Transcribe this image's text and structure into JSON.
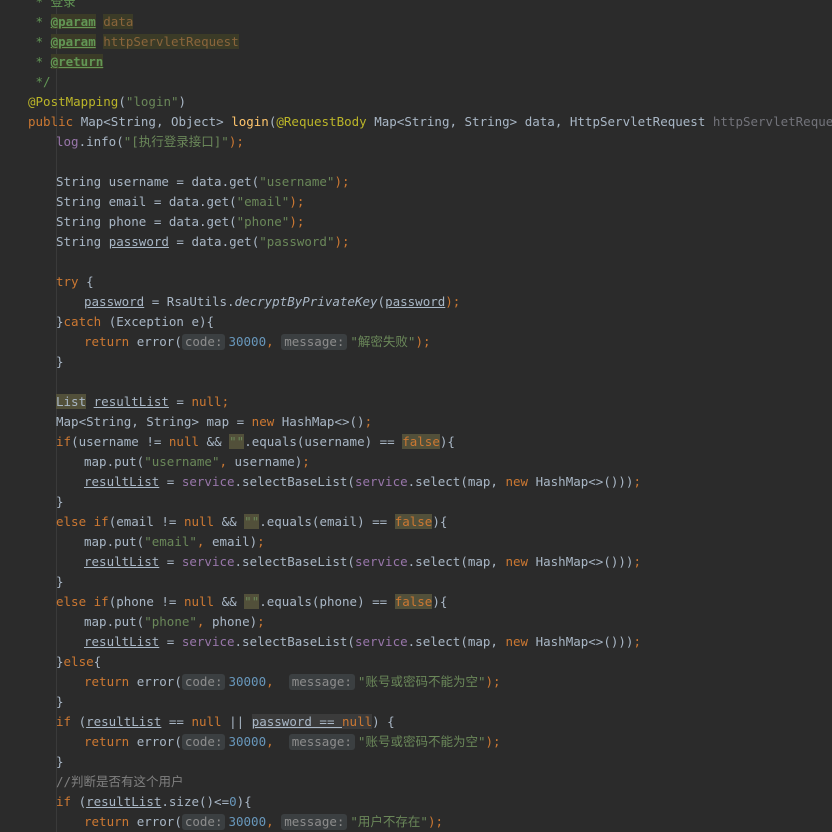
{
  "editor": {
    "lines": [
      {
        "indent": 28,
        "tokens": [
          {
            "t": " * 登录",
            "c": "t-doc"
          }
        ]
      },
      {
        "indent": 28,
        "tokens": [
          {
            "t": " * ",
            "c": "t-doc"
          },
          {
            "t": "@param",
            "c": "t-doctag t-dochl"
          },
          {
            "t": " ",
            "c": "t-doc"
          },
          {
            "t": "data",
            "c": "t-docarg t-dochl"
          }
        ]
      },
      {
        "indent": 28,
        "tokens": [
          {
            "t": " * ",
            "c": "t-doc"
          },
          {
            "t": "@param",
            "c": "t-doctag t-dochl"
          },
          {
            "t": " ",
            "c": "t-doc"
          },
          {
            "t": "httpServletRequest",
            "c": "t-docarg t-dochl"
          }
        ]
      },
      {
        "indent": 28,
        "tokens": [
          {
            "t": " * ",
            "c": "t-doc"
          },
          {
            "t": "@return",
            "c": "t-doctag t-dochl"
          }
        ]
      },
      {
        "indent": 28,
        "tokens": [
          {
            "t": " */",
            "c": "t-doc"
          }
        ]
      },
      {
        "indent": 28,
        "tokens": [
          {
            "t": "@PostMapping",
            "c": "t-ann"
          },
          {
            "t": "(",
            "c": ""
          },
          {
            "t": "\"login\"",
            "c": "t-str"
          },
          {
            "t": ")",
            "c": ""
          }
        ]
      },
      {
        "indent": 28,
        "tokens": [
          {
            "t": "public ",
            "c": "t-kw"
          },
          {
            "t": "Map<String, Object> ",
            "c": ""
          },
          {
            "t": "login",
            "c": "t-fn"
          },
          {
            "t": "(",
            "c": ""
          },
          {
            "t": "@RequestBody ",
            "c": "t-ann"
          },
          {
            "t": "Map<String, String> data, HttpServletRequest ",
            "c": ""
          },
          {
            "t": "httpServletRequest",
            "c": "t-unused"
          },
          {
            "t": ") ",
            "c": ""
          },
          {
            "t": "{",
            "c": "brace-hl"
          }
        ]
      },
      {
        "indent": 56,
        "tokens": [
          {
            "t": "log",
            "c": "t-field"
          },
          {
            "t": ".info(",
            "c": ""
          },
          {
            "t": "\"[执行登录接口]\"",
            "c": "t-str"
          },
          {
            "t": ");",
            "c": "t-kw"
          }
        ]
      },
      {
        "indent": 56,
        "tokens": []
      },
      {
        "indent": 56,
        "tokens": [
          {
            "t": "String username = data.get(",
            "c": ""
          },
          {
            "t": "\"username\"",
            "c": "t-str"
          },
          {
            "t": ");",
            "c": "t-kw"
          }
        ]
      },
      {
        "indent": 56,
        "tokens": [
          {
            "t": "String email = data.get(",
            "c": ""
          },
          {
            "t": "\"email\"",
            "c": "t-str"
          },
          {
            "t": ");",
            "c": "t-kw"
          }
        ]
      },
      {
        "indent": 56,
        "tokens": [
          {
            "t": "String phone = data.get(",
            "c": ""
          },
          {
            "t": "\"phone\"",
            "c": "t-str"
          },
          {
            "t": ");",
            "c": "t-kw"
          }
        ]
      },
      {
        "indent": 56,
        "tokens": [
          {
            "t": "String ",
            "c": ""
          },
          {
            "t": "password",
            "c": "t-ul"
          },
          {
            "t": " = data.get(",
            "c": ""
          },
          {
            "t": "\"password\"",
            "c": "t-str"
          },
          {
            "t": ");",
            "c": "t-kw"
          }
        ]
      },
      {
        "indent": 56,
        "tokens": []
      },
      {
        "indent": 56,
        "tokens": [
          {
            "t": "try ",
            "c": "t-kw"
          },
          {
            "t": "{",
            "c": ""
          }
        ]
      },
      {
        "indent": 84,
        "tokens": [
          {
            "t": "password",
            "c": "t-ul"
          },
          {
            "t": " = RsaUtils.",
            "c": ""
          },
          {
            "t": "decryptByPrivateKey",
            "c": "t-italic"
          },
          {
            "t": "(",
            "c": ""
          },
          {
            "t": "password",
            "c": "t-ul"
          },
          {
            "t": ");",
            "c": "t-kw"
          }
        ]
      },
      {
        "indent": 56,
        "tokens": [
          {
            "t": "}",
            "c": ""
          },
          {
            "t": "catch ",
            "c": "t-kw"
          },
          {
            "t": "(Exception e){",
            "c": ""
          }
        ]
      },
      {
        "indent": 84,
        "tokens": [
          {
            "t": "return ",
            "c": "t-kw"
          },
          {
            "t": "error(",
            "c": ""
          },
          {
            "t": "code:",
            "c": "hint"
          },
          {
            "t": "30000",
            "c": "t-num"
          },
          {
            "t": ", ",
            "c": "t-kw"
          },
          {
            "t": "message:",
            "c": "hint"
          },
          {
            "t": "\"解密失败\"",
            "c": "t-str"
          },
          {
            "t": ");",
            "c": "t-kw"
          }
        ]
      },
      {
        "indent": 56,
        "tokens": [
          {
            "t": "}",
            "c": ""
          }
        ]
      },
      {
        "indent": 56,
        "tokens": []
      },
      {
        "indent": 56,
        "tokens": [
          {
            "t": "List",
            "c": "t-warn"
          },
          {
            "t": " ",
            "c": ""
          },
          {
            "t": "resultList",
            "c": "t-ul"
          },
          {
            "t": " = ",
            "c": ""
          },
          {
            "t": "null",
            "c": "t-kw"
          },
          {
            "t": ";",
            "c": "t-kw"
          }
        ]
      },
      {
        "indent": 56,
        "tokens": [
          {
            "t": "Map<String, String> map = ",
            "c": ""
          },
          {
            "t": "new ",
            "c": "t-kw"
          },
          {
            "t": "HashMap<>()",
            "c": ""
          },
          {
            "t": ";",
            "c": "t-kw"
          }
        ]
      },
      {
        "indent": 56,
        "tokens": [
          {
            "t": "if",
            "c": "t-kw"
          },
          {
            "t": "(username != ",
            "c": ""
          },
          {
            "t": "null ",
            "c": "t-kw"
          },
          {
            "t": "&& ",
            "c": ""
          },
          {
            "t": "\"\"",
            "c": "t-str t-warn"
          },
          {
            "t": ".equals(username) == ",
            "c": ""
          },
          {
            "t": "false",
            "c": "t-kw t-warn"
          },
          {
            "t": "){",
            "c": ""
          }
        ]
      },
      {
        "indent": 84,
        "tokens": [
          {
            "t": "map.put(",
            "c": ""
          },
          {
            "t": "\"username\"",
            "c": "t-str"
          },
          {
            "t": ", ",
            "c": "t-kw"
          },
          {
            "t": "username)",
            "c": ""
          },
          {
            "t": ";",
            "c": "t-kw"
          }
        ]
      },
      {
        "indent": 84,
        "tokens": [
          {
            "t": "resultList",
            "c": "t-ul"
          },
          {
            "t": " = ",
            "c": ""
          },
          {
            "t": "service",
            "c": "t-field"
          },
          {
            "t": ".selectBaseList(",
            "c": ""
          },
          {
            "t": "service",
            "c": "t-field"
          },
          {
            "t": ".select(map, ",
            "c": ""
          },
          {
            "t": "new ",
            "c": "t-kw"
          },
          {
            "t": "HashMap<>()))",
            "c": ""
          },
          {
            "t": ";",
            "c": "t-kw"
          }
        ]
      },
      {
        "indent": 56,
        "tokens": [
          {
            "t": "}",
            "c": ""
          }
        ]
      },
      {
        "indent": 56,
        "tokens": [
          {
            "t": "else if",
            "c": "t-kw"
          },
          {
            "t": "(email != ",
            "c": ""
          },
          {
            "t": "null ",
            "c": "t-kw"
          },
          {
            "t": "&& ",
            "c": ""
          },
          {
            "t": "\"\"",
            "c": "t-str t-warn"
          },
          {
            "t": ".equals(email) == ",
            "c": ""
          },
          {
            "t": "false",
            "c": "t-kw t-warn"
          },
          {
            "t": "){",
            "c": ""
          }
        ]
      },
      {
        "indent": 84,
        "tokens": [
          {
            "t": "map.put(",
            "c": ""
          },
          {
            "t": "\"email\"",
            "c": "t-str"
          },
          {
            "t": ", ",
            "c": "t-kw"
          },
          {
            "t": "email)",
            "c": ""
          },
          {
            "t": ";",
            "c": "t-kw"
          }
        ]
      },
      {
        "indent": 84,
        "tokens": [
          {
            "t": "resultList",
            "c": "t-ul"
          },
          {
            "t": " = ",
            "c": ""
          },
          {
            "t": "service",
            "c": "t-field"
          },
          {
            "t": ".selectBaseList(",
            "c": ""
          },
          {
            "t": "service",
            "c": "t-field"
          },
          {
            "t": ".select(map, ",
            "c": ""
          },
          {
            "t": "new ",
            "c": "t-kw"
          },
          {
            "t": "HashMap<>()))",
            "c": ""
          },
          {
            "t": ";",
            "c": "t-kw"
          }
        ]
      },
      {
        "indent": 56,
        "tokens": [
          {
            "t": "}",
            "c": ""
          }
        ]
      },
      {
        "indent": 56,
        "tokens": [
          {
            "t": "else if",
            "c": "t-kw"
          },
          {
            "t": "(phone != ",
            "c": ""
          },
          {
            "t": "null ",
            "c": "t-kw"
          },
          {
            "t": "&& ",
            "c": ""
          },
          {
            "t": "\"\"",
            "c": "t-str t-warn"
          },
          {
            "t": ".equals(phone) == ",
            "c": ""
          },
          {
            "t": "false",
            "c": "t-kw t-warn"
          },
          {
            "t": "){",
            "c": ""
          }
        ]
      },
      {
        "indent": 84,
        "tokens": [
          {
            "t": "map.put(",
            "c": ""
          },
          {
            "t": "\"phone\"",
            "c": "t-str"
          },
          {
            "t": ", ",
            "c": "t-kw"
          },
          {
            "t": "phone)",
            "c": ""
          },
          {
            "t": ";",
            "c": "t-kw"
          }
        ]
      },
      {
        "indent": 84,
        "tokens": [
          {
            "t": "resultList",
            "c": "t-ul"
          },
          {
            "t": " = ",
            "c": ""
          },
          {
            "t": "service",
            "c": "t-field"
          },
          {
            "t": ".selectBaseList(",
            "c": ""
          },
          {
            "t": "service",
            "c": "t-field"
          },
          {
            "t": ".select(map, ",
            "c": ""
          },
          {
            "t": "new ",
            "c": "t-kw"
          },
          {
            "t": "HashMap<>()))",
            "c": ""
          },
          {
            "t": ";",
            "c": "t-kw"
          }
        ]
      },
      {
        "indent": 56,
        "tokens": [
          {
            "t": "}",
            "c": ""
          },
          {
            "t": "else",
            "c": "t-kw"
          },
          {
            "t": "{",
            "c": ""
          }
        ]
      },
      {
        "indent": 84,
        "tokens": [
          {
            "t": "return ",
            "c": "t-kw"
          },
          {
            "t": "error(",
            "c": ""
          },
          {
            "t": "code:",
            "c": "hint"
          },
          {
            "t": "30000",
            "c": "t-num"
          },
          {
            "t": ",  ",
            "c": "t-kw"
          },
          {
            "t": "message:",
            "c": "hint"
          },
          {
            "t": "\"账号或密码不能为空\"",
            "c": "t-str"
          },
          {
            "t": ");",
            "c": "t-kw"
          }
        ]
      },
      {
        "indent": 56,
        "tokens": [
          {
            "t": "}",
            "c": ""
          }
        ]
      },
      {
        "indent": 56,
        "tokens": [
          {
            "t": "if ",
            "c": "t-kw"
          },
          {
            "t": "(",
            "c": ""
          },
          {
            "t": "resultList",
            "c": "t-ul"
          },
          {
            "t": " == ",
            "c": ""
          },
          {
            "t": "null ",
            "c": "t-kw"
          },
          {
            "t": "|| ",
            "c": ""
          },
          {
            "t": "password == ",
            "c": "t-ul t-box"
          },
          {
            "t": "null",
            "c": "t-kw t-box"
          },
          {
            "t": ") {",
            "c": ""
          }
        ]
      },
      {
        "indent": 84,
        "tokens": [
          {
            "t": "return ",
            "c": "t-kw"
          },
          {
            "t": "error(",
            "c": ""
          },
          {
            "t": "code:",
            "c": "hint"
          },
          {
            "t": "30000",
            "c": "t-num"
          },
          {
            "t": ",  ",
            "c": "t-kw"
          },
          {
            "t": "message:",
            "c": "hint"
          },
          {
            "t": "\"账号或密码不能为空\"",
            "c": "t-str"
          },
          {
            "t": ");",
            "c": "t-kw"
          }
        ]
      },
      {
        "indent": 56,
        "tokens": [
          {
            "t": "}",
            "c": ""
          }
        ]
      },
      {
        "indent": 56,
        "tokens": [
          {
            "t": "//判断是否有这个用户",
            "c": "t-cmt"
          }
        ]
      },
      {
        "indent": 56,
        "tokens": [
          {
            "t": "if ",
            "c": "t-kw"
          },
          {
            "t": "(",
            "c": ""
          },
          {
            "t": "resultList",
            "c": "t-ul"
          },
          {
            "t": ".size()<=",
            "c": ""
          },
          {
            "t": "0",
            "c": "t-num"
          },
          {
            "t": "){",
            "c": ""
          }
        ]
      },
      {
        "indent": 84,
        "tokens": [
          {
            "t": "return ",
            "c": "t-kw"
          },
          {
            "t": "error(",
            "c": ""
          },
          {
            "t": "code:",
            "c": "hint"
          },
          {
            "t": "30000",
            "c": "t-num"
          },
          {
            "t": ", ",
            "c": "t-kw"
          },
          {
            "t": "message:",
            "c": "hint"
          },
          {
            "t": "\"用户不存在\"",
            "c": "t-str"
          },
          {
            "t": ");",
            "c": "t-kw"
          }
        ]
      }
    ]
  }
}
